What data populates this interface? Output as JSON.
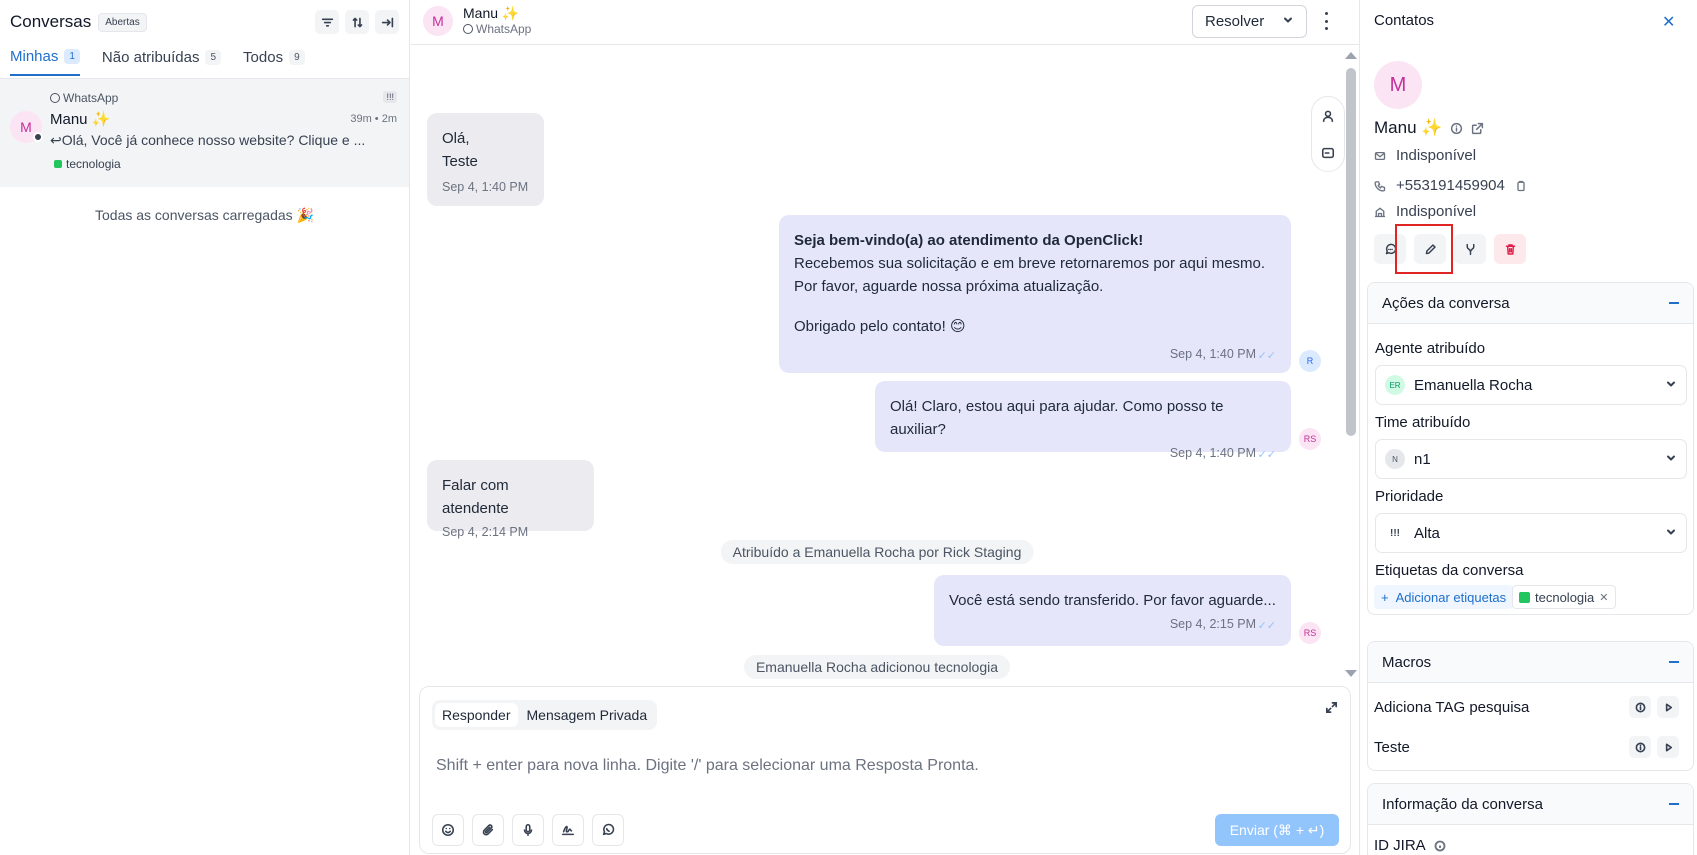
{
  "sidebar": {
    "title": "Conversas",
    "status_filter": "Abertas",
    "tabs": [
      {
        "label": "Minhas",
        "count": "1"
      },
      {
        "label": "Não atribuídas",
        "count": "5"
      },
      {
        "label": "Todos",
        "count": "9"
      }
    ],
    "conversation": {
      "avatar_letter": "M",
      "inbox": "WhatsApp",
      "priority": "!!!",
      "name": "Manu ✨",
      "time": "39m • 2m",
      "last_message": "Olá, Você já conhece nosso website? Clique e ...",
      "tag": "tecnologia"
    },
    "all_loaded": "Todas as conversas carregadas 🎉"
  },
  "chat": {
    "contact_name": "Manu ✨",
    "avatar_letter": "M",
    "inbox": "WhatsApp",
    "resolve_label": "Resolver",
    "messages": [
      {
        "dir": "in",
        "lines": [
          "Olá,",
          "Teste"
        ],
        "time": "Sep 4, 1:40 PM"
      },
      {
        "dir": "out",
        "bold": "Seja bem-vindo(a) ao atendimento da OpenClick!",
        "lines": [
          "Recebemos sua solicitação e em breve retornaremos por aqui mesmo.",
          "Por favor, aguarde nossa próxima atualização.",
          "Obrigado pelo contato! 😊"
        ],
        "time": "Sep 4, 1:40 PM",
        "avatar": "R"
      },
      {
        "dir": "out",
        "text": "Olá! Claro, estou aqui para ajudar. Como posso te auxiliar?",
        "time": "Sep 4, 1:40 PM",
        "avatar": "RS"
      },
      {
        "dir": "in",
        "text": "Falar com atendente",
        "time": "Sep 4, 2:14 PM"
      },
      {
        "dir": "out",
        "text": "Você está sendo transferido. Por favor aguarde...",
        "time": "Sep 4, 2:15 PM",
        "avatar": "RS"
      }
    ],
    "activities": [
      "Atribuído a Emanuella Rocha por Rick Staging",
      "Emanuella Rocha adicionou tecnologia"
    ],
    "tick": "✓✓",
    "composer": {
      "tab_reply": "Responder",
      "tab_private": "Mensagem Privada",
      "placeholder": "Shift + enter para nova linha. Digite '/' para selecionar uma Resposta Pronta.",
      "send_label": "Enviar (⌘ + ↵)"
    }
  },
  "contact": {
    "panel_title": "Contatos",
    "close": "✕",
    "avatar_letter": "M",
    "name": "Manu ✨",
    "email": "Indisponível",
    "phone": "+553191459904",
    "company": "Indisponível",
    "sections": {
      "actions_title": "Ações da conversa",
      "agent_label": "Agente atribuído",
      "agent_initials": "ER",
      "agent_name": "Emanuella Rocha",
      "team_label": "Time atribuído",
      "team_initial": "N",
      "team_name": "n1",
      "priority_label": "Prioridade",
      "priority_icon": "!!!",
      "priority_value": "Alta",
      "tags_label": "Etiquetas da conversa",
      "add_tags": "Adicionar etiquetas",
      "tag": "tecnologia",
      "tag_remove": "✕",
      "macros_title": "Macros",
      "macros": [
        "Adiciona TAG pesquisa",
        "Teste"
      ],
      "info_title": "Informação da conversa",
      "info_field": "ID JIRA"
    }
  },
  "colors": {
    "accent": "#1f6fcb",
    "incoming_bubble": "#ebebf0",
    "outgoing_bubble": "#e6e6fb",
    "tag_green": "#22c55e",
    "highlight": "#e02424"
  }
}
